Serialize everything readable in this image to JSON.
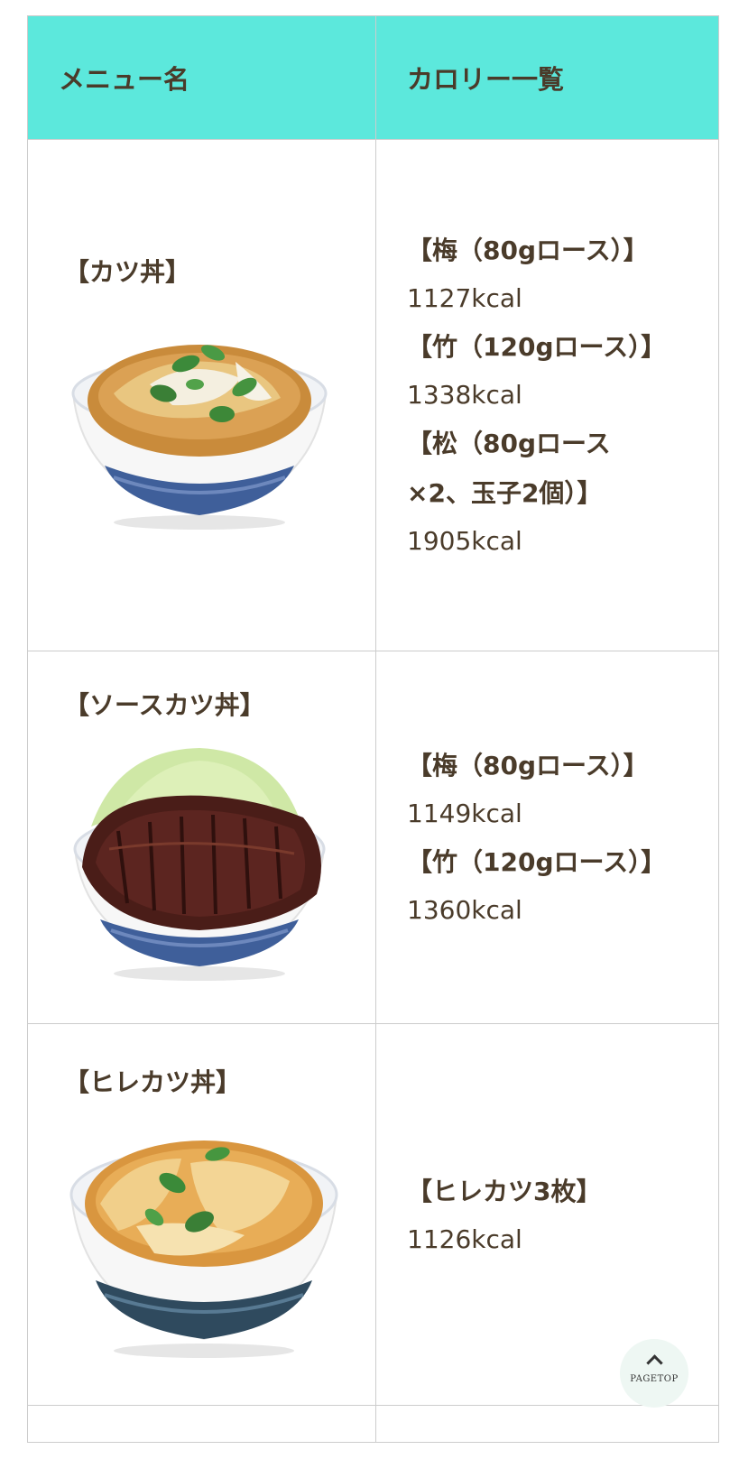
{
  "table": {
    "header": {
      "menu_name": "メニュー名",
      "calorie_list": "カロリー一覧"
    },
    "rows": [
      {
        "name": "【カツ丼】",
        "image_icon": "katsudon-bowl-photo",
        "entries": [
          {
            "label": "【梅（80gロース）】",
            "kcal": "1127kcal"
          },
          {
            "label": "【竹（120gロース）】",
            "kcal": "1338kcal"
          },
          {
            "label": "【松（80gロース×2、玉子2個）】",
            "kcal": "1905kcal"
          }
        ]
      },
      {
        "name": "【ソースカツ丼】",
        "image_icon": "sauce-katsudon-bowl-photo",
        "entries": [
          {
            "label": "【梅（80gロース）】",
            "kcal": "1149kcal"
          },
          {
            "label": "【竹（120gロース）】",
            "kcal": "1360kcal"
          }
        ]
      },
      {
        "name": "【ヒレカツ丼】",
        "image_icon": "hire-katsudon-bowl-photo",
        "entries": [
          {
            "label": "【ヒレカツ3枚】",
            "kcal": "1126kcal"
          }
        ]
      }
    ]
  },
  "pagetop": {
    "label": "PAGETOP"
  },
  "colors": {
    "header_bg": "#5ce8dc",
    "text": "#4a3b2a",
    "border": "#cccccc"
  }
}
